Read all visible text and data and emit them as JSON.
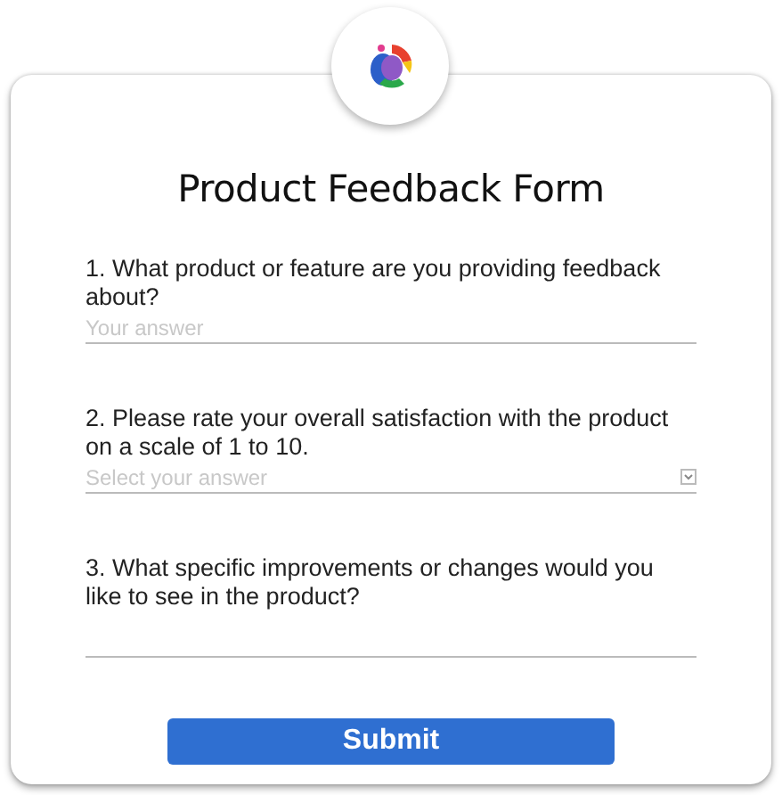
{
  "form": {
    "title": "Product Feedback Form",
    "questions": [
      {
        "label": "1. What product or feature are you providing feedback about?",
        "kind": "text",
        "placeholder": "Your answer"
      },
      {
        "label": "2. Please rate your overall satisfaction with the product on a scale of 1 to 10.",
        "kind": "select",
        "placeholder": "Select your answer"
      },
      {
        "label": "3. What specific improvements or changes would you like to see in the product?",
        "kind": "text"
      }
    ],
    "submit": "Submit"
  }
}
